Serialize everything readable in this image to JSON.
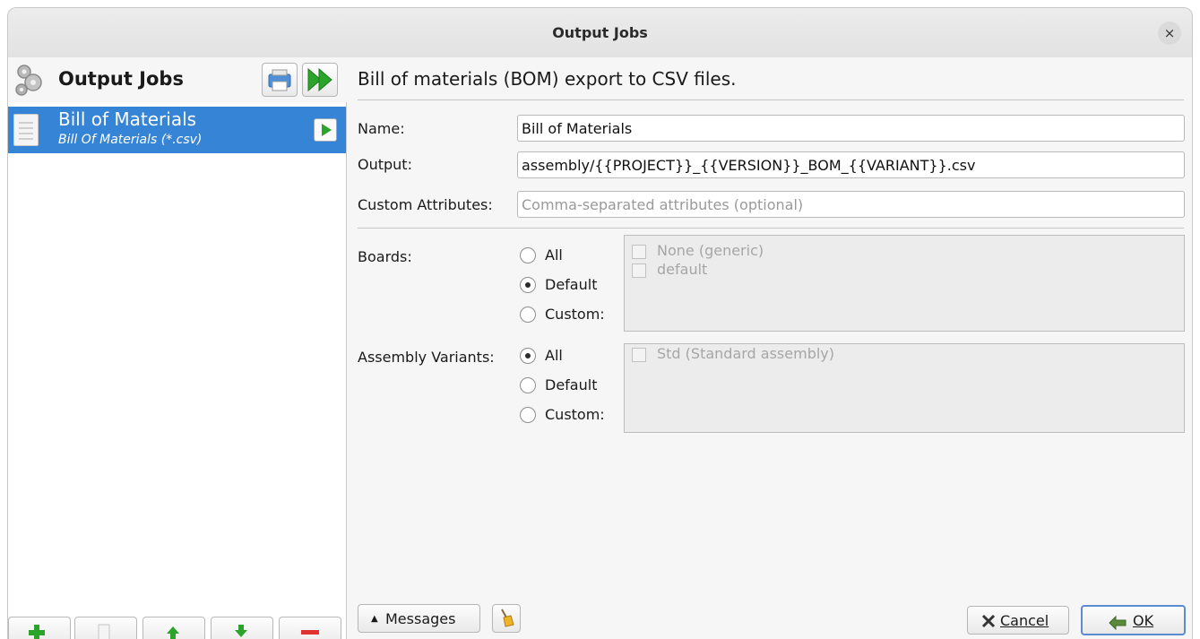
{
  "window": {
    "title": "Output Jobs",
    "close_glyph": "×"
  },
  "left": {
    "header_title": "Output Jobs",
    "header_icon": "gears-icon",
    "jobs": [
      {
        "name": "Bill of Materials",
        "type": "Bill Of Materials (*.csv)"
      }
    ]
  },
  "form": {
    "description": "Bill of materials (BOM) export to CSV files.",
    "name_label": "Name:",
    "name_value": "Bill of Materials",
    "output_label": "Output:",
    "output_value": "assembly/{{PROJECT}}_{{VERSION}}_BOM_{{VARIANT}}.csv",
    "custom_attr_label": "Custom Attributes:",
    "custom_attr_placeholder": "Comma-separated attributes (optional)",
    "boards_label": "Boards:",
    "boards_options": [
      "All",
      "Default",
      "Custom:"
    ],
    "boards_selected": "Default",
    "boards_list": [
      "None (generic)",
      "default"
    ],
    "variants_label": "Assembly Variants:",
    "variants_options": [
      "All",
      "Default",
      "Custom:"
    ],
    "variants_selected": "All",
    "variants_list": [
      "Std (Standard assembly)"
    ]
  },
  "footer": {
    "messages_label": "Messages",
    "messages_arrow": "▲",
    "cancel_label": "Cancel",
    "ok_label": "OK"
  },
  "colors": {
    "selection": "#3584d6",
    "accent_green": "#2aa52a",
    "remove_red": "#e03030"
  }
}
